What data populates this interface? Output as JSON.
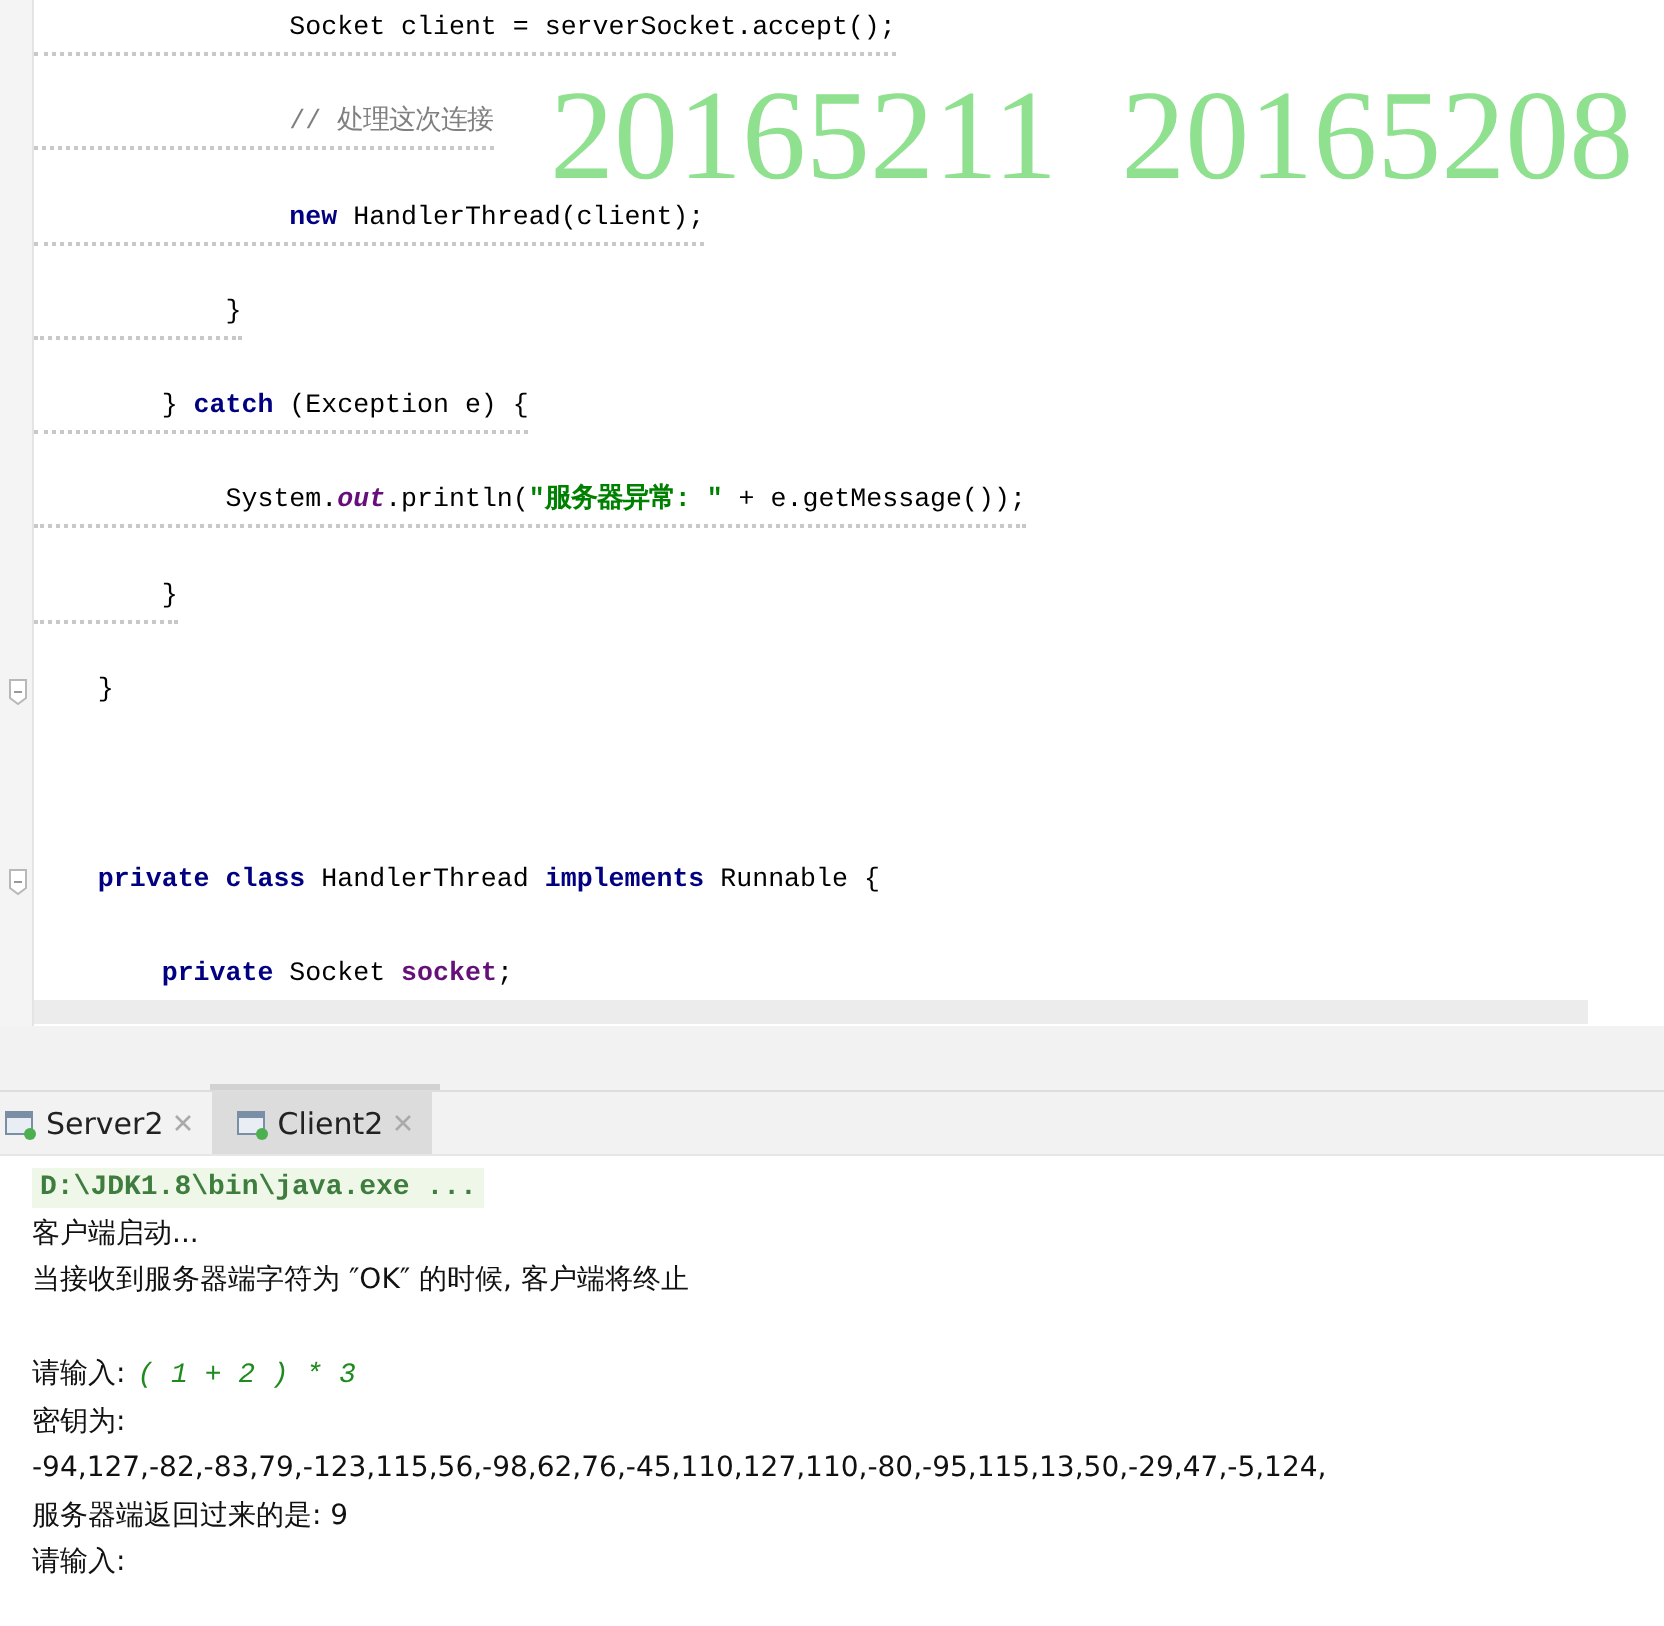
{
  "editor": {
    "lines": [
      {
        "kind": "code",
        "underlined": true,
        "fold": false,
        "tokens": [
          {
            "kind": "plain",
            "text": "                Socket client = serverSocket.accept();"
          }
        ]
      },
      {
        "kind": "code",
        "underlined": true,
        "fold": false,
        "tokens": [
          {
            "kind": "comment",
            "text": "                // 处理这次连接"
          }
        ]
      },
      {
        "kind": "code",
        "underlined": true,
        "fold": false,
        "tokens": [
          {
            "kind": "keyword",
            "text": "                new"
          },
          {
            "kind": "plain",
            "text": " HandlerThread(client);"
          }
        ]
      },
      {
        "kind": "code",
        "underlined": true,
        "fold": false,
        "tokens": [
          {
            "kind": "plain",
            "text": "            }"
          }
        ]
      },
      {
        "kind": "code",
        "underlined": true,
        "fold": false,
        "tokens": [
          {
            "kind": "plain",
            "text": "        } "
          },
          {
            "kind": "keyword",
            "text": "catch"
          },
          {
            "kind": "plain",
            "text": " (Exception e) {"
          }
        ]
      },
      {
        "kind": "code",
        "underlined": true,
        "fold": false,
        "tokens": [
          {
            "kind": "plain",
            "text": "            System."
          },
          {
            "kind": "static",
            "text": "out"
          },
          {
            "kind": "plain",
            "text": ".println("
          },
          {
            "kind": "string",
            "text": "\"服务器异常: \""
          },
          {
            "kind": "plain",
            "text": " + e.getMessage());"
          }
        ]
      },
      {
        "kind": "code",
        "underlined": true,
        "fold": false,
        "tokens": [
          {
            "kind": "plain",
            "text": "        }"
          }
        ]
      },
      {
        "kind": "code",
        "underlined": false,
        "fold": true,
        "tokens": [
          {
            "kind": "plain",
            "text": "    }"
          }
        ]
      },
      {
        "kind": "blank"
      },
      {
        "kind": "code",
        "underlined": false,
        "fold": true,
        "tokens": [
          {
            "kind": "keyword",
            "text": "    private class"
          },
          {
            "kind": "plain",
            "text": " HandlerThread "
          },
          {
            "kind": "keyword",
            "text": "implements"
          },
          {
            "kind": "plain",
            "text": " Runnable {"
          }
        ]
      },
      {
        "kind": "code",
        "underlined": false,
        "fold": false,
        "tokens": [
          {
            "kind": "keyword",
            "text": "        private"
          },
          {
            "kind": "plain",
            "text": " Socket "
          },
          {
            "kind": "field",
            "text": "socket"
          },
          {
            "kind": "plain",
            "text": ";"
          }
        ]
      }
    ]
  },
  "overlay_text": "20165211  20165208",
  "run_tabs": [
    {
      "label": "Server2",
      "selected": false
    },
    {
      "label": "Client2",
      "selected": true
    }
  ],
  "console": {
    "lines": [
      {
        "kind": "command",
        "text": "D:\\JDK1.8\\bin\\java.exe ..."
      },
      {
        "kind": "output",
        "text": "客户端启动..."
      },
      {
        "kind": "output",
        "text": "当接收到服务器端字符为 ″OK″ 的时候, 客户端将终止"
      },
      {
        "kind": "blank"
      },
      {
        "kind": "prompt",
        "text": "请输入:",
        "input": "( 1 + 2 ) * 3"
      },
      {
        "kind": "output",
        "text": "密钥为:"
      },
      {
        "kind": "output",
        "text": "-94,127,-82,-83,79,-123,115,56,-98,62,76,-45,110,127,110,-80,-95,115,13,50,-29,47,-5,124,"
      },
      {
        "kind": "output",
        "text": "服务器端返回过来的是: 9"
      },
      {
        "kind": "output",
        "text": "请输入:"
      }
    ]
  }
}
